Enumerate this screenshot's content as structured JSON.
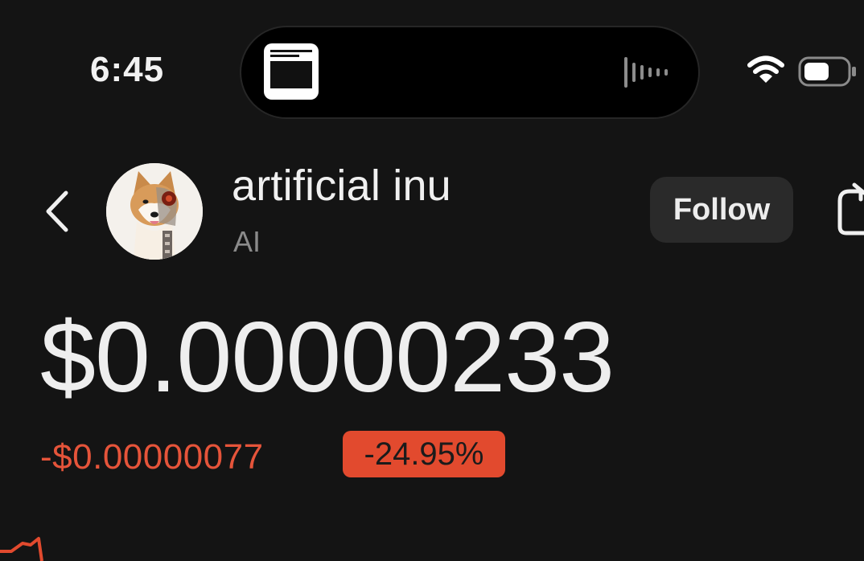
{
  "status_bar": {
    "time": "6:45"
  },
  "header": {
    "token_name": "artificial inu",
    "token_symbol": "AI",
    "follow_label": "Follow"
  },
  "price": {
    "current": "$0.00000233",
    "change_value": "-$0.00000077",
    "change_percent": "-24.95%"
  },
  "colors": {
    "background": "#141414",
    "negative": "#e24a2e",
    "button_bg": "#2a2a2a"
  },
  "icons": {
    "back": "chevron-left-icon",
    "share": "share-icon",
    "wifi": "wifi-icon",
    "battery": "battery-icon"
  }
}
